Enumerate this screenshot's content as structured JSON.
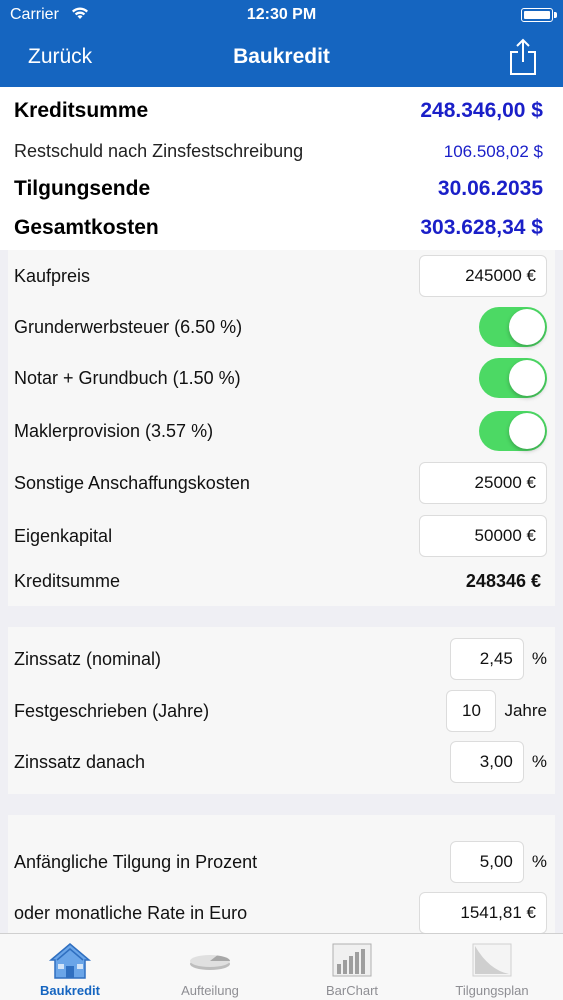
{
  "status": {
    "carrier": "Carrier",
    "time": "12:30 PM"
  },
  "nav": {
    "back": "Zurück",
    "title": "Baukredit"
  },
  "summary": {
    "kreditsumme": {
      "label": "Kreditsumme",
      "value": "248.346,00 $"
    },
    "restschuld": {
      "label": "Restschuld nach Zinsfestschreibung",
      "value": "106.508,02 $"
    },
    "tilgungsende": {
      "label": "Tilgungsende",
      "value": "30.06.2035"
    },
    "gesamtkosten": {
      "label": "Gesamtkosten",
      "value": "303.628,34 $"
    }
  },
  "purchase": {
    "kaufpreis": {
      "label": "Kaufpreis",
      "value": "245000 €"
    },
    "grunderwerbsteuer": {
      "label": "Grunderwerbsteuer (6.50 %)",
      "on": true
    },
    "notar": {
      "label": "Notar + Grundbuch (1.50 %)",
      "on": true
    },
    "makler": {
      "label": "Maklerprovision (3.57 %)",
      "on": true
    },
    "sonstige": {
      "label": "Sonstige Anschaffungskosten",
      "value": "25000 €"
    },
    "eigenkapital": {
      "label": "Eigenkapital",
      "value": "50000 €"
    },
    "kreditsumme": {
      "label": "Kreditsumme",
      "value": "248346 €"
    }
  },
  "interest": {
    "zinssatz": {
      "label": "Zinssatz (nominal)",
      "value": "2,45",
      "unit": "%"
    },
    "festgeschrieben": {
      "label": "Festgeschrieben (Jahre)",
      "value": "10",
      "unit": "Jahre"
    },
    "danach": {
      "label": "Zinssatz danach",
      "value": "3,00",
      "unit": "%"
    }
  },
  "repayment": {
    "tilgung": {
      "label": "Anfängliche Tilgung in Prozent",
      "value": "5,00",
      "unit": "%"
    },
    "rate": {
      "label": "oder monatliche Rate in Euro",
      "value": "1541,81 €"
    }
  },
  "tabs": [
    {
      "label": "Baukredit",
      "icon": "house-icon",
      "active": true
    },
    {
      "label": "Aufteilung",
      "icon": "pie-icon",
      "active": false
    },
    {
      "label": "BarChart",
      "icon": "bar-chart-icon",
      "active": false
    },
    {
      "label": "Tilgungsplan",
      "icon": "curve-chart-icon",
      "active": false
    }
  ],
  "colors": {
    "accent": "#1565c0",
    "value_blue": "#1a1fc8",
    "toggle_on": "#4cd964"
  }
}
